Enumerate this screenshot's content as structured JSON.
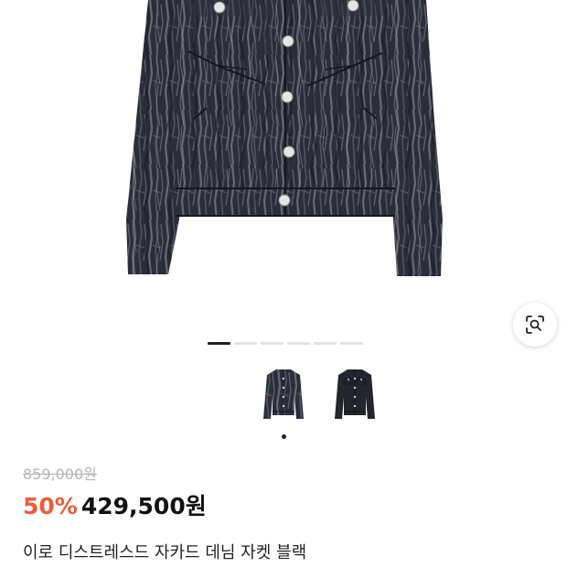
{
  "product": {
    "original_price": "859,000원",
    "discount_rate": "50%",
    "sale_price": "429,500원",
    "name": "이로 디스트레스드 자카드 데님 자켓 블랙"
  },
  "gallery": {
    "page_count": 6,
    "active_page": 1,
    "thumbnails": [
      {
        "name": "distressed-jacquard-jacket",
        "selected": true
      },
      {
        "name": "plain-black-jacket",
        "selected": false
      }
    ]
  },
  "icons": {
    "lens": "visual-search-icon"
  },
  "colors": {
    "discount": "#f05a3a",
    "original_price": "#b5b5b5",
    "pager_active": "#222222",
    "pager_inactive": "#e2e2e2"
  }
}
